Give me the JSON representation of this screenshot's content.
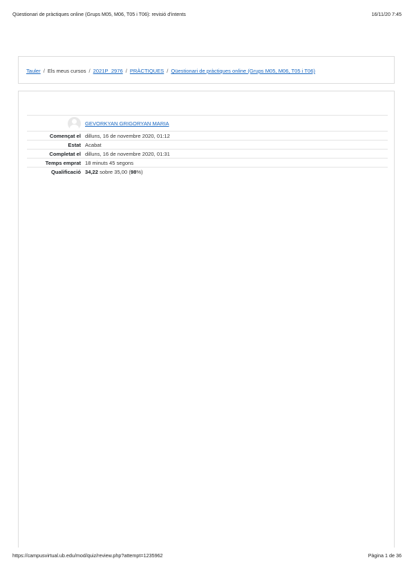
{
  "print_header": {
    "title": "Qüestionari de pràctiques online (Grups M05, M06, T05 i T06): revisió d'intents",
    "datetime": "16/11/20 7:45"
  },
  "breadcrumb": {
    "items": [
      {
        "label": "Tauler",
        "link": true
      },
      {
        "label": "Els meus cursos",
        "link": false
      },
      {
        "label": "2021P_2976",
        "link": true
      },
      {
        "label": "PRÀCTIQUES",
        "link": true
      },
      {
        "label": "Qüestionari de pràctiques online (Grups M05, M06, T05 i T06)",
        "link": true
      }
    ],
    "separator": "/"
  },
  "summary": {
    "user_name": "GEVORKYAN GRIGORYAN MARIA",
    "started_label": "Començat el",
    "started_value": "dilluns, 16 de novembre 2020, 01:12",
    "state_label": "Estat",
    "state_value": "Acabat",
    "completed_label": "Completat el",
    "completed_value": "dilluns, 16 de novembre 2020, 01:31",
    "time_label": "Temps emprat",
    "time_value": "18 minuts 45 segons",
    "grade_label": "Qualificació",
    "grade_score": "34,22",
    "grade_rest": " sobre 35,00 (",
    "grade_percent": "98",
    "grade_end": "%)"
  },
  "print_footer": {
    "url": "https://campusvirtual.ub.edu/mod/quiz/review.php?attempt=1235962",
    "page": "Pàgina 1 de 36"
  }
}
